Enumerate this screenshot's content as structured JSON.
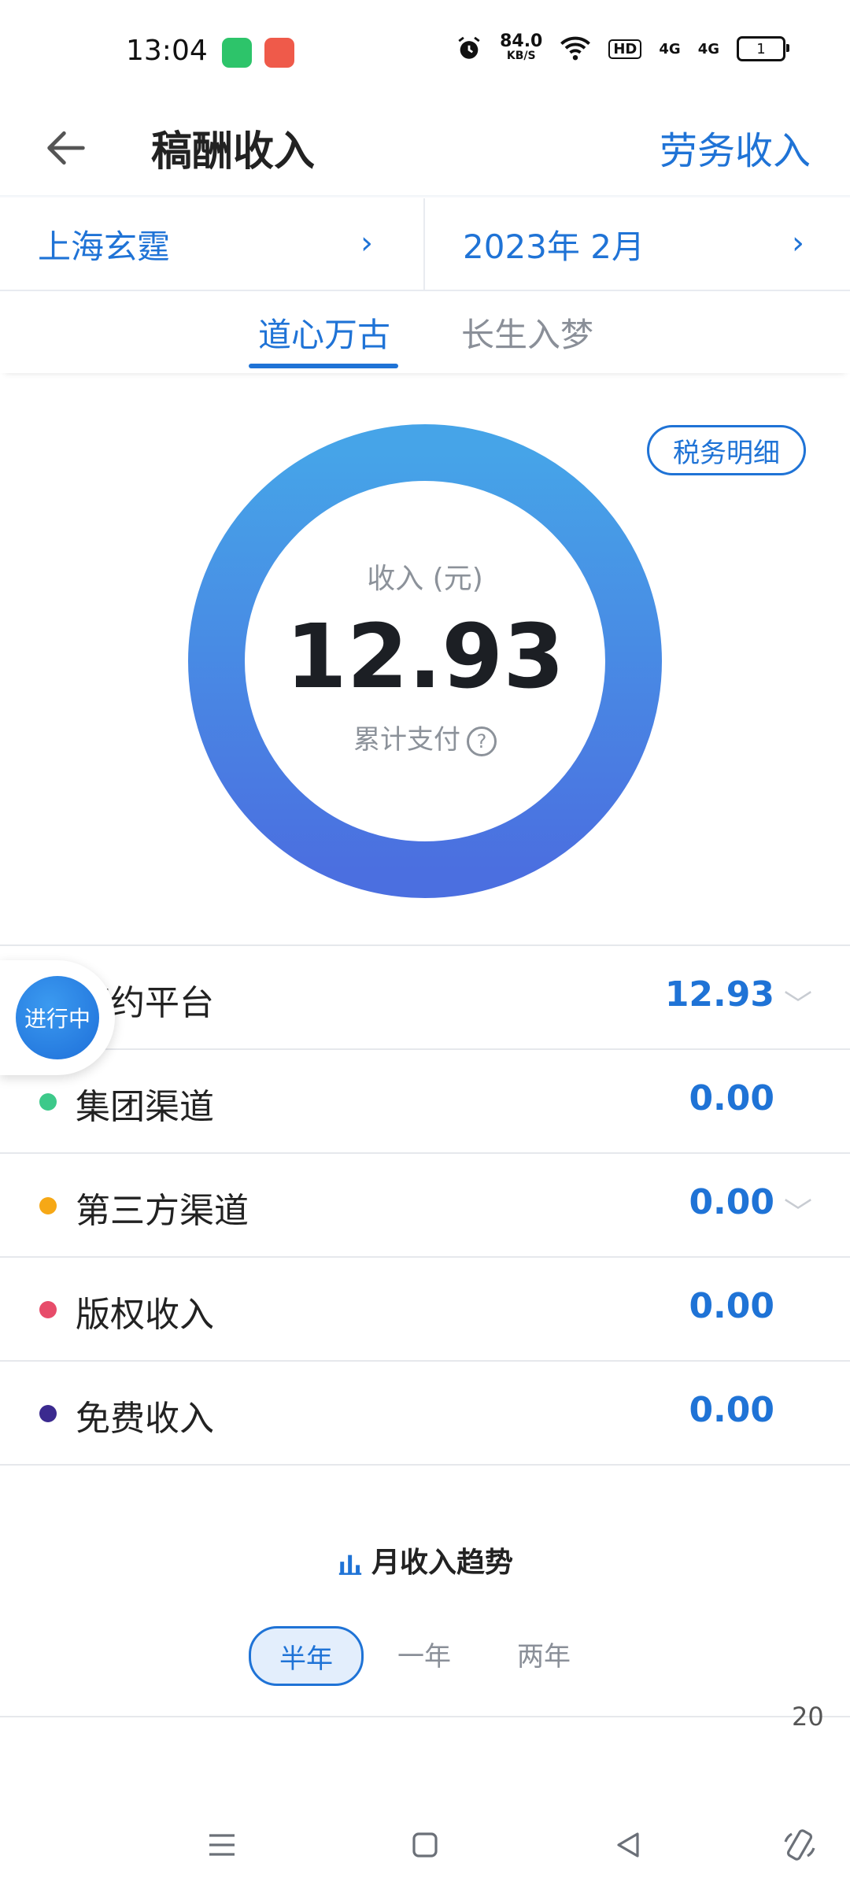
{
  "status_bar": {
    "time": "13:04",
    "net_speed": "84.0",
    "net_unit": "KB/S",
    "hd": "HD",
    "signal1": "4G",
    "signal2": "4G",
    "battery": "1"
  },
  "header": {
    "title": "稿酬收入",
    "right_link": "劳务收入"
  },
  "filters": {
    "company": "上海玄霆",
    "date": "2023年 2月"
  },
  "tabs": [
    {
      "label": "道心万古",
      "active": true
    },
    {
      "label": "长生入梦",
      "active": false
    }
  ],
  "tax_detail": "税务明细",
  "donut": {
    "label": "收入 (元)",
    "value": "12.93",
    "sub": "累计支付",
    "help": "?"
  },
  "float_badge": "进行中",
  "rows": [
    {
      "label": "签约平台",
      "value": "12.93",
      "color": "",
      "expandable": true
    },
    {
      "label": "集团渠道",
      "value": "0.00",
      "color": "#3dc98a",
      "expandable": false
    },
    {
      "label": "第三方渠道",
      "value": "0.00",
      "color": "#f6a816",
      "expandable": true
    },
    {
      "label": "版权收入",
      "value": "0.00",
      "color": "#e74c6a",
      "expandable": false
    },
    {
      "label": "免费收入",
      "value": "0.00",
      "color": "#3b2a8f",
      "expandable": false
    }
  ],
  "trend": {
    "title": "月收入趋势",
    "ranges": [
      "半年",
      "一年",
      "两年"
    ],
    "y_tick": "20"
  },
  "colors": {
    "accent": "#1f73d6",
    "donut_top": "#46a4e8",
    "donut_bottom": "#4b6fe0"
  }
}
